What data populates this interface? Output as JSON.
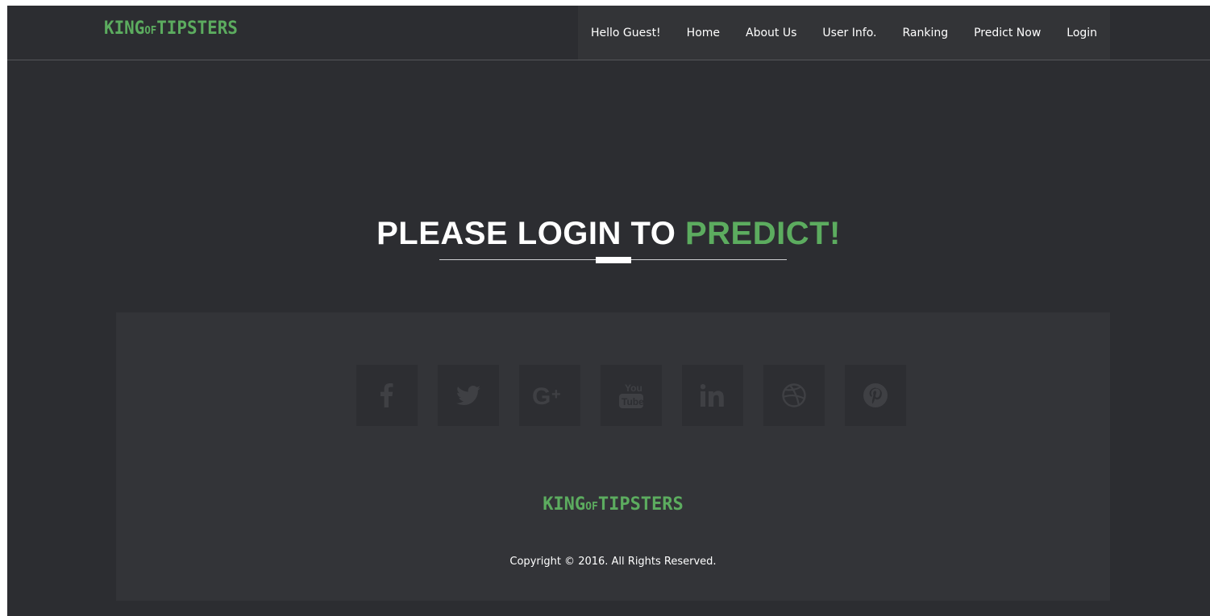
{
  "brand": {
    "logo_main_1": "KING",
    "logo_of": "OF",
    "logo_main_2": "TIPSTERS",
    "color": "#5cac5f"
  },
  "nav": {
    "items": [
      {
        "label": "Hello Guest!"
      },
      {
        "label": "Home"
      },
      {
        "label": "About Us"
      },
      {
        "label": "User Info."
      },
      {
        "label": "Ranking"
      },
      {
        "label": "Predict Now"
      },
      {
        "label": "Login"
      }
    ]
  },
  "hero": {
    "title_main": "PLEASE LOGIN TO ",
    "title_accent": "PREDICT!"
  },
  "footer": {
    "socials": [
      {
        "icon": "facebook-icon"
      },
      {
        "icon": "twitter-icon"
      },
      {
        "icon": "google-plus-icon"
      },
      {
        "icon": "youtube-icon"
      },
      {
        "icon": "linkedin-icon"
      },
      {
        "icon": "dribbble-icon"
      },
      {
        "icon": "pinterest-icon"
      }
    ],
    "copyright": "Copyright © 2016. All Rights Reserved."
  },
  "colors": {
    "background": "#2c2d31",
    "panel": "#333438",
    "accent": "#5cac5f",
    "text": "#ffffff"
  }
}
